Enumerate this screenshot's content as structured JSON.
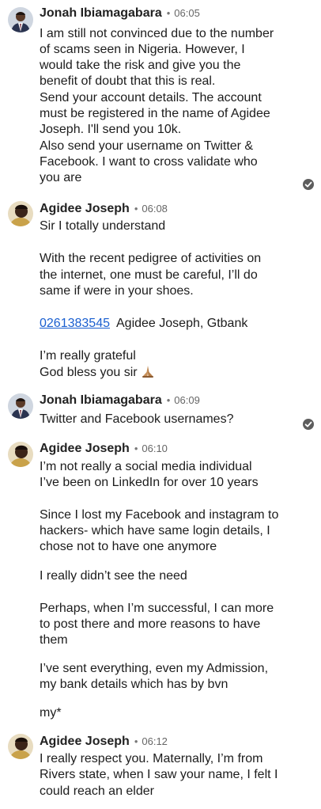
{
  "messages": [
    {
      "sender": "Jonah Ibiamagabara",
      "time": "06:05",
      "lines": [
        "I am still not convinced due to the number",
        "of scams seen in Nigeria. However, I",
        "would take the risk and give you the",
        "benefit of doubt that this is real.",
        "Send your account details. The account",
        "must be registered in the name of Agidee",
        "Joseph. I'll send you 10k.",
        "Also send your username on Twitter &",
        "Facebook. I want to cross validate who",
        "you are"
      ]
    },
    {
      "sender": "Agidee Joseph",
      "time": "06:08",
      "lines": [
        "Sir I totally understand",
        "With the recent pedigree of activities on",
        "the internet, one must be careful, I’ll do",
        "same if were in your shoes.",
        "Agidee Joseph, Gtbank",
        "I’m really grateful",
        "God bless you sir"
      ],
      "account_link": "0261383545"
    },
    {
      "sender": "Jonah Ibiamagabara",
      "time": "06:09",
      "lines": [
        "Twitter and Facebook usernames?"
      ]
    },
    {
      "sender": "Agidee Joseph",
      "time": "06:10",
      "lines": [
        "I’m not really a social media individual",
        "I’ve been on LinkedIn for over 10 years",
        "Since I lost my Facebook and instagram to",
        "hackers- which have same login details, I",
        "chose not to have one anymore",
        "I really didn’t see the need",
        "Perhaps, when I’m successful, I can more",
        "to post there and more reasons to have",
        "them",
        "I’ve sent everything, even my Admission,",
        "my bank details which has by bvn",
        "my*"
      ]
    },
    {
      "sender": "Agidee Joseph",
      "time": "06:12",
      "lines": [
        "I really respect you.  Maternally, I’m from",
        "Rivers state, when I saw your name, I felt I",
        "could reach an elder"
      ]
    }
  ],
  "separator": "•",
  "icons": {
    "read_receipt": "check-circle-icon",
    "pray_emoji": "praying-hands-icon"
  },
  "colors": {
    "link": "#1a5fd0",
    "text": "#1c1c1c",
    "meta": "#666666",
    "check_bg": "#5d5d5d"
  }
}
